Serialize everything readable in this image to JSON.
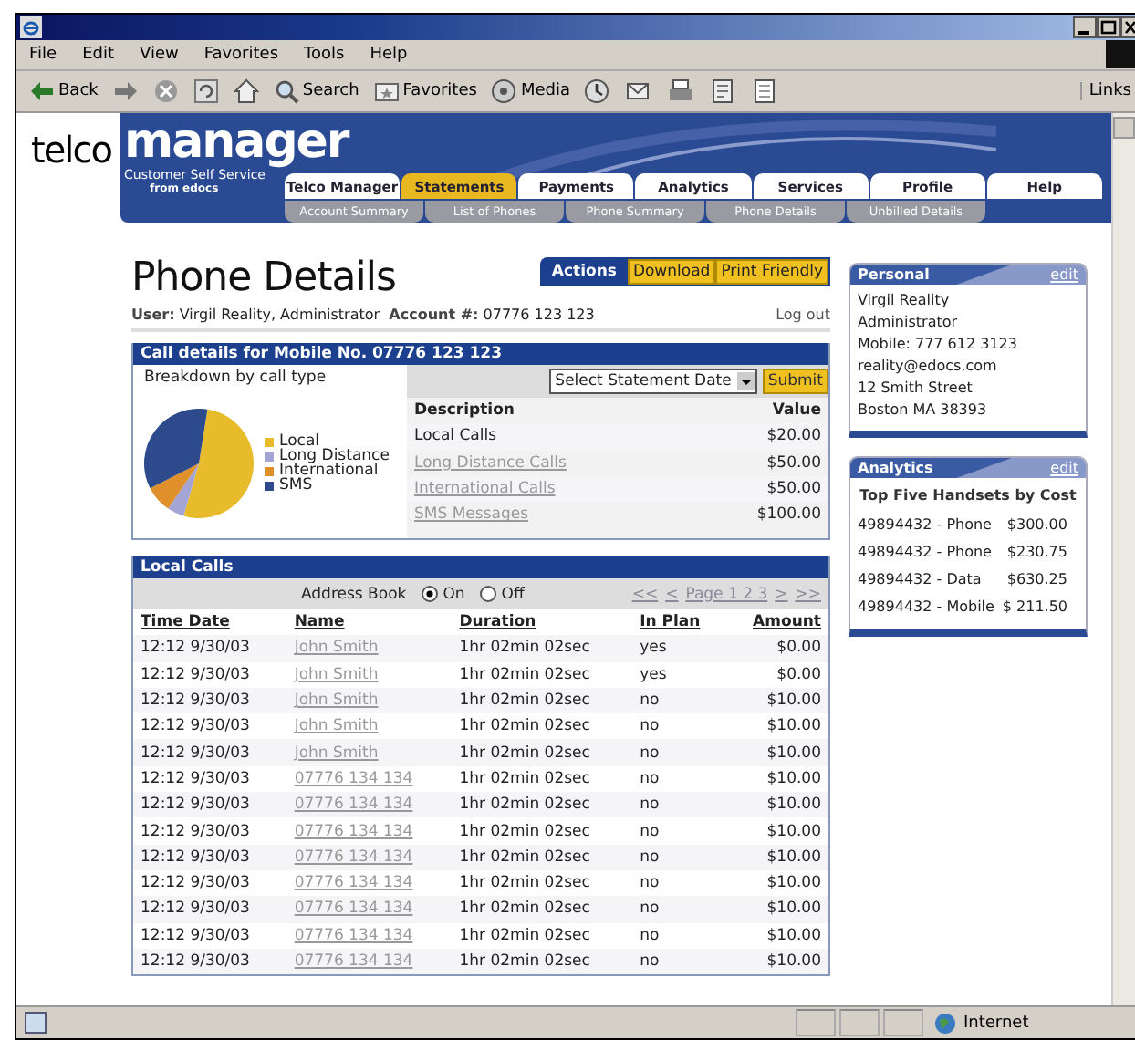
{
  "menu": [
    "File",
    "Edit",
    "View",
    "Favorites",
    "Tools",
    "Help"
  ],
  "toolbar": [
    {
      "kind": "back",
      "label": "Back"
    },
    {
      "kind": "forward"
    },
    {
      "kind": "stop"
    },
    {
      "kind": "refresh"
    },
    {
      "kind": "home"
    },
    {
      "kind": "search",
      "label": "Search"
    },
    {
      "kind": "favorites",
      "label": "Favorites"
    },
    {
      "kind": "media",
      "label": "Media"
    },
    {
      "kind": "history"
    },
    {
      "kind": "mail"
    },
    {
      "kind": "print"
    },
    {
      "kind": "edit"
    },
    {
      "kind": "discuss"
    }
  ],
  "links": "Links",
  "brand": {
    "word1": "telco",
    "word2": "manager",
    "tagline": "Customer Self Service",
    "by": "from edocs"
  },
  "tabs": [
    {
      "label": "Telco Manager",
      "selected": false
    },
    {
      "label": "Statements",
      "selected": true
    },
    {
      "label": "Payments",
      "selected": false
    },
    {
      "label": "Analytics",
      "selected": false
    },
    {
      "label": "Services",
      "selected": false
    },
    {
      "label": "Profile",
      "selected": false
    },
    {
      "label": "Help",
      "selected": false
    }
  ],
  "subtabs": [
    "Account Summary",
    "List of Phones",
    "Phone Summary",
    "Phone Details",
    "Unbilled Details"
  ],
  "page": {
    "title": "Phone Details",
    "user_label": "User:",
    "user": "Virgil Reality, Administrator",
    "account_label": "Account #:",
    "account": "07776 123 123",
    "logout": "Log out"
  },
  "actions": {
    "label": "Actions",
    "buttons": [
      "Download",
      "Print Friendly"
    ]
  },
  "call_details": {
    "title": "Call details for Mobile No. 07776 123 123",
    "breakdown_label": "Breakdown by call type",
    "legend": [
      {
        "label": "Local",
        "color": "#e8bb2a"
      },
      {
        "label": "Long Distance",
        "color": "#a3a6d4"
      },
      {
        "label": "International",
        "color": "#e0902a"
      },
      {
        "label": "SMS",
        "color": "#2c4a8c"
      }
    ],
    "select": "Select Statement Date",
    "submit": "Submit",
    "columns": [
      "Description",
      "Value"
    ],
    "rows": [
      {
        "description": "Local Calls",
        "value": "$20.00",
        "link": false
      },
      {
        "description": "Long Distance Calls",
        "value": "$50.00",
        "link": true
      },
      {
        "description": "International Calls",
        "value": "$50.00",
        "link": true
      },
      {
        "description": "SMS Messages",
        "value": "$100.00",
        "link": true
      }
    ]
  },
  "local_calls": {
    "title": "Local Calls",
    "address_book": "Address Book",
    "options": [
      {
        "label": "On",
        "selected": true
      },
      {
        "label": "Off",
        "selected": false
      }
    ],
    "pager": [
      {
        "label": "<<",
        "disabled": true
      },
      {
        "label": "<",
        "disabled": true
      },
      {
        "label": "Page 1 2 3",
        "disabled": true
      },
      {
        "label": ">",
        "disabled": true
      },
      {
        "label": ">>",
        "disabled": true
      }
    ],
    "columns": [
      "Time Date",
      "Name",
      "Duration",
      "In Plan",
      "Amount"
    ],
    "rows": [
      {
        "time": "12:12 9/30/03",
        "name": "John Smith",
        "duration": "1hr 02min 02sec",
        "in_plan": "yes",
        "amount": "$0.00"
      },
      {
        "time": "12:12 9/30/03",
        "name": "John Smith",
        "duration": "1hr 02min 02sec",
        "in_plan": "yes",
        "amount": "$0.00"
      },
      {
        "time": "12:12 9/30/03",
        "name": "John Smith",
        "duration": "1hr 02min 02sec",
        "in_plan": "no",
        "amount": "$10.00"
      },
      {
        "time": "12:12 9/30/03",
        "name": "John Smith",
        "duration": "1hr 02min 02sec",
        "in_plan": "no",
        "amount": "$10.00"
      },
      {
        "time": "12:12 9/30/03",
        "name": "John Smith",
        "duration": "1hr 02min 02sec",
        "in_plan": "no",
        "amount": "$10.00"
      },
      {
        "time": "12:12 9/30/03",
        "name": "07776 134 134",
        "duration": "1hr 02min 02sec",
        "in_plan": "no",
        "amount": "$10.00"
      },
      {
        "time": "12:12 9/30/03",
        "name": "07776 134 134",
        "duration": "1hr 02min 02sec",
        "in_plan": "no",
        "amount": "$10.00"
      },
      {
        "time": "12:12 9/30/03",
        "name": "07776 134 134",
        "duration": "1hr 02min 02sec",
        "in_plan": "no",
        "amount": "$10.00"
      },
      {
        "time": "12:12 9/30/03",
        "name": "07776 134 134",
        "duration": "1hr 02min 02sec",
        "in_plan": "no",
        "amount": "$10.00"
      },
      {
        "time": "12:12 9/30/03",
        "name": "07776 134 134",
        "duration": "1hr 02min 02sec",
        "in_plan": "no",
        "amount": "$10.00"
      },
      {
        "time": "12:12 9/30/03",
        "name": "07776 134 134",
        "duration": "1hr 02min 02sec",
        "in_plan": "no",
        "amount": "$10.00"
      },
      {
        "time": "12:12 9/30/03",
        "name": "07776 134 134",
        "duration": "1hr 02min 02sec",
        "in_plan": "no",
        "amount": "$10.00"
      },
      {
        "time": "12:12 9/30/03",
        "name": "07776 134 134",
        "duration": "1hr 02min 02sec",
        "in_plan": "no",
        "amount": "$10.00"
      }
    ]
  },
  "personal": {
    "title": "Personal",
    "edit": "edit",
    "lines": [
      "Virgil Reality",
      "Administrator",
      "Mobile: 777 612 3123",
      "reality@edocs.com",
      "12 Smith Street",
      "Boston MA 38393"
    ]
  },
  "analytics": {
    "title": "Analytics",
    "edit": "edit",
    "heading": "Top Five Handsets by Cost",
    "rows": [
      {
        "handset": "49894432 - Phone",
        "cost": "$300.00"
      },
      {
        "handset": "49894432 - Phone",
        "cost": "$230.75"
      },
      {
        "handset": "49894432 - Data",
        "cost": "$630.25"
      },
      {
        "handset": "49894432 - Mobile",
        "cost": "$ 211.50"
      }
    ]
  },
  "status_bar": {
    "zone": "Internet"
  }
}
